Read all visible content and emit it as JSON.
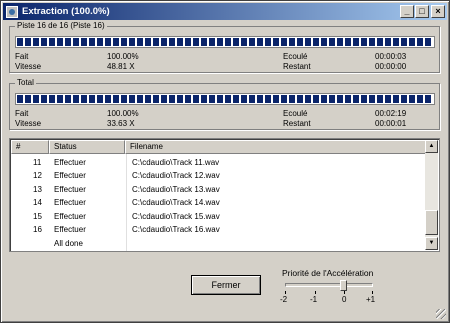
{
  "window": {
    "title": "Extraction (100.0%)"
  },
  "titlebar_buttons": {
    "minimize": "_",
    "maximize": "□",
    "close": "×"
  },
  "track_group": {
    "label": "Piste 16 de 16 (Piste 16)",
    "progress_fraction": 1.0,
    "done_label": "Fait",
    "done_value": "100.00%",
    "speed_label": "Vitesse",
    "speed_value": "48.81 X",
    "elapsed_label": "Ecoulé",
    "elapsed_value": "00:00:03",
    "remaining_label": "Restant",
    "remaining_value": "00:00:00"
  },
  "total_group": {
    "label": "Total",
    "progress_fraction": 1.0,
    "done_label": "Fait",
    "done_value": "100.00%",
    "speed_label": "Vitesse",
    "speed_value": "33.63 X",
    "elapsed_label": "Ecoulé",
    "elapsed_value": "00:02:19",
    "remaining_label": "Restant",
    "remaining_value": "00:00:01"
  },
  "list": {
    "columns": [
      "#",
      "Status",
      "Filename"
    ],
    "rows": [
      {
        "num": "11",
        "status": "Effectuer",
        "file": "C:\\cdaudio\\Track 11.wav"
      },
      {
        "num": "12",
        "status": "Effectuer",
        "file": "C:\\cdaudio\\Track 12.wav"
      },
      {
        "num": "13",
        "status": "Effectuer",
        "file": "C:\\cdaudio\\Track 13.wav"
      },
      {
        "num": "14",
        "status": "Effectuer",
        "file": "C:\\cdaudio\\Track 14.wav"
      },
      {
        "num": "15",
        "status": "Effectuer",
        "file": "C:\\cdaudio\\Track 15.wav"
      },
      {
        "num": "16",
        "status": "Effectuer",
        "file": "C:\\cdaudio\\Track 16.wav"
      },
      {
        "num": "",
        "status": "All done",
        "file": ""
      }
    ]
  },
  "close_button": {
    "label": "Fermer"
  },
  "priority": {
    "label": "Priorité de l'Accélération",
    "ticks": [
      "-2",
      "-1",
      "0",
      "+1"
    ],
    "value": "0"
  }
}
